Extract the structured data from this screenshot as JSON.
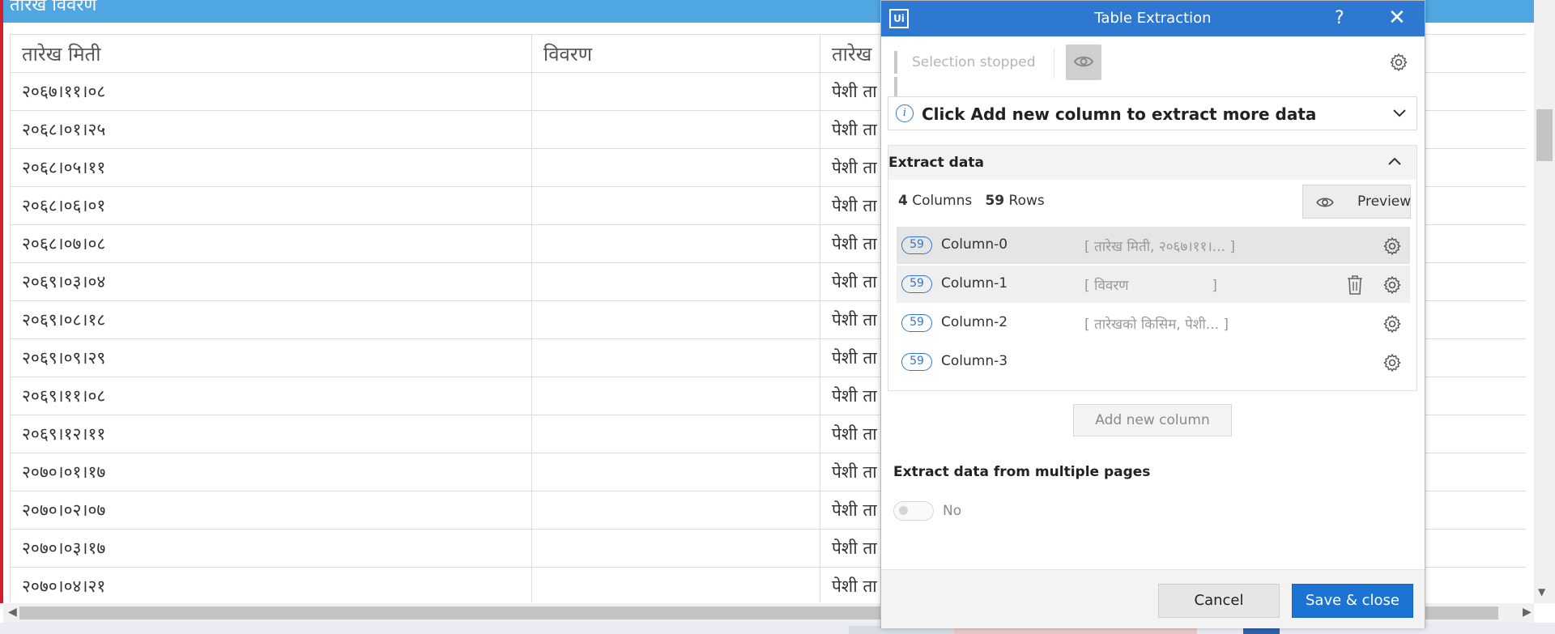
{
  "background_page": {
    "header_title": "तारेख विवरण",
    "table": {
      "columns": [
        "तारेख मिती",
        "विवरण",
        "तारेख"
      ],
      "rows": [
        [
          "२०६७।११।०८",
          "",
          "पेशी ता"
        ],
        [
          "२०६८।०१।२५",
          "",
          "पेशी ता"
        ],
        [
          "२०६८।०५।११",
          "",
          "पेशी ता"
        ],
        [
          "२०६८।०६।०१",
          "",
          "पेशी ता"
        ],
        [
          "२०६८।०७।०८",
          "",
          "पेशी ता"
        ],
        [
          "२०६९।०३।०४",
          "",
          "पेशी ता"
        ],
        [
          "२०६९।०८।१८",
          "",
          "पेशी ता"
        ],
        [
          "२०६९।०९।२९",
          "",
          "पेशी ता"
        ],
        [
          "२०६९।११।०८",
          "",
          "पेशी ता"
        ],
        [
          "२०६९।१२।११",
          "",
          "पेशी ता"
        ],
        [
          "२०७०।०१।१७",
          "",
          "पेशी ता"
        ],
        [
          "२०७०।०२।०७",
          "",
          "पेशी ता"
        ],
        [
          "२०७०।०३।१७",
          "",
          "पेशी ता"
        ],
        [
          "२०७०।०४।२१",
          "",
          "पेशी ता"
        ]
      ]
    }
  },
  "dialog": {
    "logo": "Ui",
    "title": "Table Extraction",
    "help": "?",
    "close": "✕",
    "toolbar": {
      "selection_status": "Selection stopped"
    },
    "info_banner": "Click Add new column to extract more data",
    "extract_section": {
      "heading": "Extract data",
      "columns_count": "4",
      "columns_word": "Columns",
      "rows_count": "59",
      "rows_word": "Rows",
      "preview_label": "Preview",
      "columns": [
        {
          "badge": "59",
          "name": "Column-0",
          "preview": "[ तारेख मिती, २०६७।११।... ]"
        },
        {
          "badge": "59",
          "name": "Column-1",
          "preview": "[ विवरण                   ]"
        },
        {
          "badge": "59",
          "name": "Column-2",
          "preview": "[ तारेखको किसिम, पेशी... ]"
        },
        {
          "badge": "59",
          "name": "Column-3",
          "preview": ""
        }
      ]
    },
    "add_column_label": "Add new column",
    "multi_pages_label": "Extract data from multiple pages",
    "multi_pages_value": "No",
    "cancel_label": "Cancel",
    "save_label": "Save & close"
  },
  "colors": {
    "titlebar": "#2e78d2",
    "primary_button": "#1b74d4",
    "header_band": "#4fa6e0",
    "left_edge": "#d11f2b"
  }
}
